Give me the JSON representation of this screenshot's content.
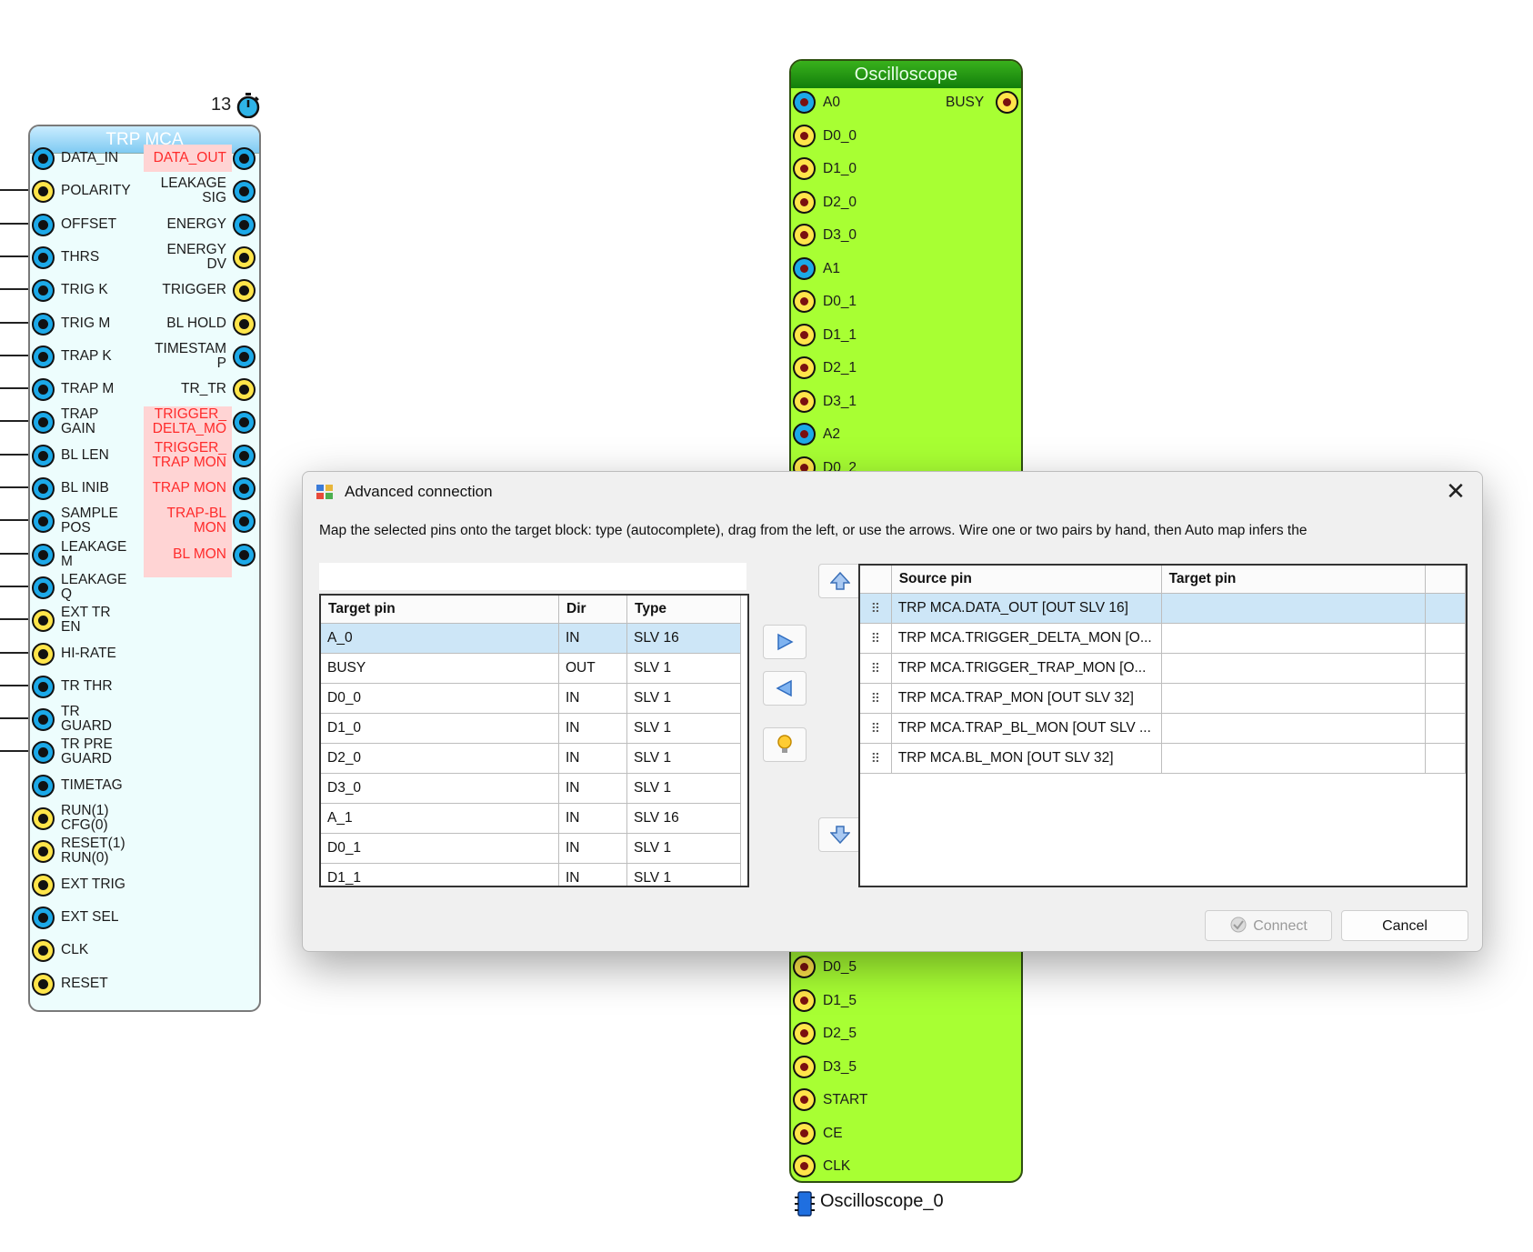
{
  "trp": {
    "title": "TRP MCA",
    "count": "13",
    "left_pins": [
      "DATA_IN",
      "POLARITY",
      "OFFSET",
      "THRS",
      "TRIG K",
      "TRIG M",
      "TRAP K",
      "TRAP M",
      "TRAP\nGAIN",
      "BL LEN",
      "BL INIB",
      "SAMPLE\nPOS",
      "LEAKAGE\nM",
      "LEAKAGE\nQ",
      "EXT TR\nEN",
      "HI-RATE",
      "TR THR",
      "TR\nGUARD",
      "TR PRE\nGUARD",
      "TIMETAG",
      "RUN(1)\nCFG(0)",
      "RESET(1)\nRUN(0)",
      "EXT TRIG",
      "EXT SEL",
      "CLK",
      "RESET"
    ],
    "right_pins": [
      "DATA_OUT",
      "LEAKAGE\nSIG",
      "ENERGY",
      "ENERGY\nDV",
      "TRIGGER",
      "BL HOLD",
      "TIMESTAM\nP",
      "TR_TR",
      "TRIGGER_\nDELTA_MO",
      "TRIGGER_\nTRAP MON",
      "TRAP MON",
      "TRAP-BL\nMON",
      "BL MON"
    ]
  },
  "osc": {
    "title": "Oscilloscope",
    "busy_label": "BUSY",
    "top_pins": [
      "A0",
      "D0_0",
      "D1_0",
      "D2_0",
      "D3_0",
      "A1",
      "D0_1",
      "D1_1",
      "D2_1",
      "D3_1",
      "A2",
      "D0_2"
    ],
    "bottom_pins": [
      "D0_5",
      "D1_5",
      "D2_5",
      "D3_5",
      "START",
      "CE",
      "CLK"
    ],
    "caption": "Oscilloscope_0"
  },
  "dialog": {
    "title": "Advanced connection",
    "description": "Map the selected pins onto the target block: type (autocomplete), drag from the left, or use the arrows. Wire one or two pairs by hand, then Auto map infers the",
    "filter_value": "",
    "left_columns": [
      "Target pin",
      "Dir",
      "Type"
    ],
    "left_rows": [
      [
        "A_0",
        "IN",
        "SLV 16"
      ],
      [
        "BUSY",
        "OUT",
        "SLV 1"
      ],
      [
        "D0_0",
        "IN",
        "SLV 1"
      ],
      [
        "D1_0",
        "IN",
        "SLV 1"
      ],
      [
        "D2_0",
        "IN",
        "SLV 1"
      ],
      [
        "D3_0",
        "IN",
        "SLV 1"
      ],
      [
        "A_1",
        "IN",
        "SLV 16"
      ],
      [
        "D0_1",
        "IN",
        "SLV 1"
      ],
      [
        "D1_1",
        "IN",
        "SLV 1"
      ]
    ],
    "right_columns": [
      "Source pin",
      "Target pin"
    ],
    "right_rows": [
      [
        "TRP MCA.DATA_OUT  [OUT SLV 16]",
        ""
      ],
      [
        "TRP MCA.TRIGGER_DELTA_MON  [O...",
        ""
      ],
      [
        "TRP MCA.TRIGGER_TRAP_MON  [O...",
        ""
      ],
      [
        "TRP MCA.TRAP_MON  [OUT SLV 32]",
        ""
      ],
      [
        "TRP MCA.TRAP_BL_MON  [OUT SLV ...",
        ""
      ],
      [
        "TRP MCA.BL_MON  [OUT SLV 32]",
        ""
      ]
    ],
    "connect_label": "Connect",
    "cancel_label": "Cancel",
    "close_glyph": "✕"
  }
}
